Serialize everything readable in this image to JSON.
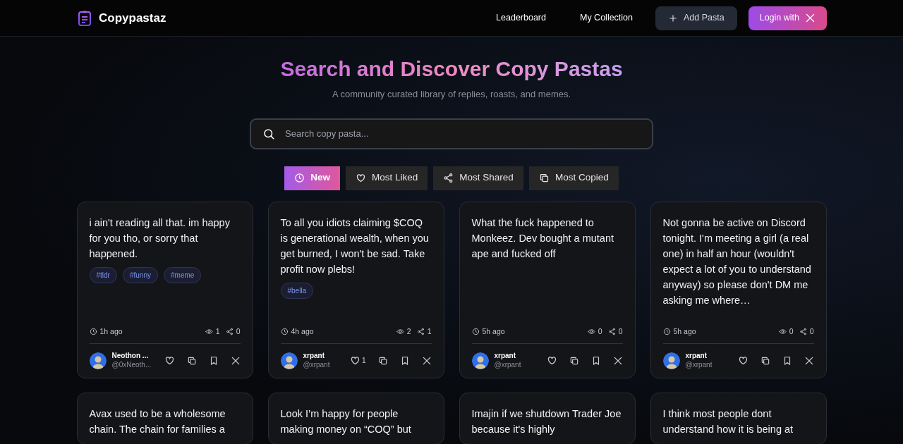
{
  "brand": {
    "name": "Copypastaz"
  },
  "nav": {
    "links": [
      "Leaderboard",
      "My Collection"
    ],
    "add_button": "Add Pasta",
    "login_button": "Login with"
  },
  "hero": {
    "title": "Search and Discover Copy Pastas",
    "subtitle": "A community curated library of replies, roasts, and memes."
  },
  "search": {
    "placeholder": "Search copy pasta..."
  },
  "filters": [
    {
      "label": "New",
      "kind": "clock",
      "selected": true
    },
    {
      "label": "Most Liked",
      "kind": "heart",
      "selected": false
    },
    {
      "label": "Most Shared",
      "kind": "share",
      "selected": false
    },
    {
      "label": "Most Copied",
      "kind": "copy",
      "selected": false
    }
  ],
  "cards": [
    {
      "text": "i ain't reading all that. im happy for you tho, or sorry that happened.",
      "tags": [
        "#tldr",
        "#funny",
        "#meme"
      ],
      "time": "1h ago",
      "views": "1",
      "shares": "0",
      "author": "Neothon ...",
      "handle": "@0xNeoth..."
    },
    {
      "text": "To all you idiots claiming $COQ is generational wealth, when you get burned, I won't be sad. Take profit now plebs!",
      "tags": [
        "#bella"
      ],
      "time": "4h ago",
      "views": "2",
      "shares": "1",
      "author": "xrpant",
      "handle": "@xrpant",
      "likes": "1"
    },
    {
      "text": "What the fuck happened to Monkeez. Dev bought a mutant ape and fucked off",
      "time": "5h ago",
      "views": "0",
      "shares": "0",
      "author": "xrpant",
      "handle": "@xrpant"
    },
    {
      "text": "Not gonna be active on Discord tonight. I'm meeting a girl (a real one) in half an hour (wouldn't expect a lot of you to understand anyway) so please don't DM me asking me where…",
      "time": "5h ago",
      "views": "0",
      "shares": "0",
      "author": "xrpant",
      "handle": "@xrpant"
    },
    {
      "text": "Avax used to be a wholesome chain. The chain for families a"
    },
    {
      "text": "Look I’m happy for people making money on “COQ” but"
    },
    {
      "text": "Imajin if we shutdown Trader Joe because it's highly"
    },
    {
      "text": "I think most people dont understand how it is being at"
    }
  ]
}
